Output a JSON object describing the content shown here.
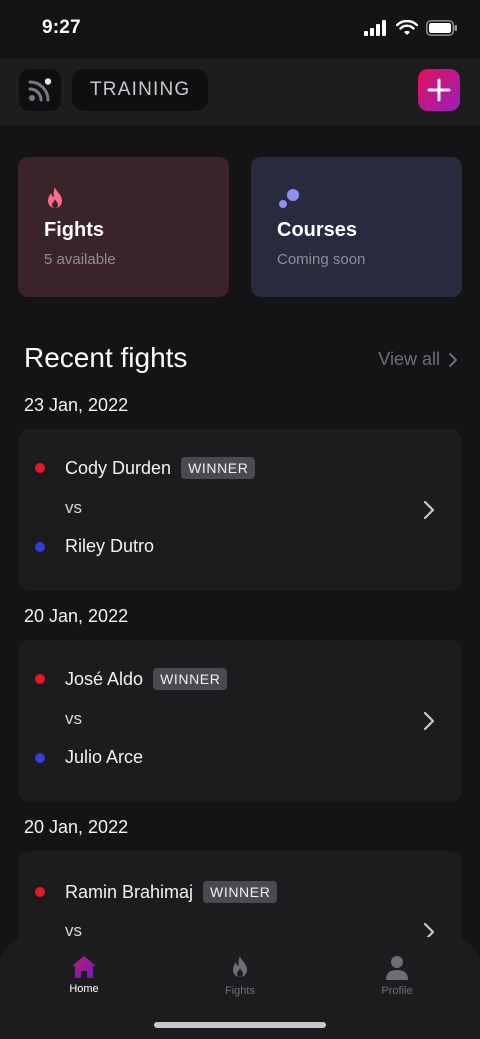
{
  "status": {
    "time": "9:27"
  },
  "header": {
    "training_label": "TRAINING"
  },
  "cards": {
    "fights": {
      "title": "Fights",
      "subtitle": "5 available",
      "accent": "#ff6b8a"
    },
    "courses": {
      "title": "Courses",
      "subtitle": "Coming soon",
      "accent": "#8f8ff5"
    }
  },
  "recent": {
    "title": "Recent fights",
    "view_all": "View all",
    "fights": [
      {
        "date": "23 Jan, 2022",
        "red": "Cody Durden",
        "blue": "Riley Dutro",
        "winner_label": "WINNER",
        "vs": "vs"
      },
      {
        "date": "20 Jan, 2022",
        "red": "José Aldo",
        "blue": "Julio Arce",
        "winner_label": "WINNER",
        "vs": "vs"
      },
      {
        "date": "20 Jan, 2022",
        "red": "Ramin Brahimaj",
        "blue": "",
        "winner_label": "WINNER",
        "vs": "vs"
      }
    ]
  },
  "tabs": [
    {
      "label": "Home",
      "icon": "home-icon",
      "active": true
    },
    {
      "label": "Fights",
      "icon": "flame-icon",
      "active": false
    },
    {
      "label": "Profile",
      "icon": "user-icon",
      "active": false
    }
  ],
  "colors": {
    "red_corner": "#e01b24",
    "blue_corner": "#2f3fd8",
    "brand_gradient_start": "#e0125a",
    "brand_gradient_end": "#9a1fbf"
  }
}
